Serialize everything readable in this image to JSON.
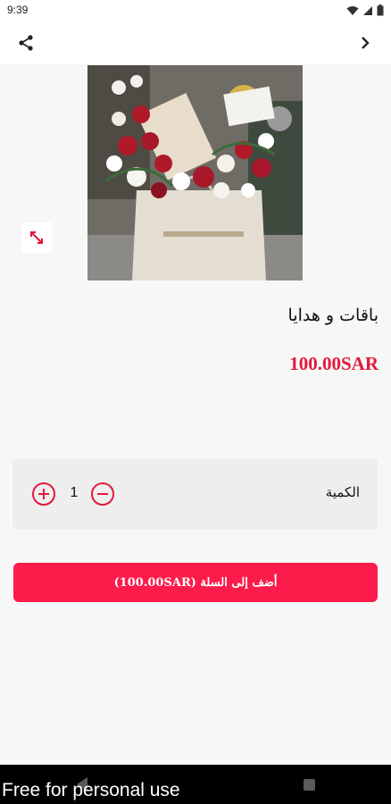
{
  "status_bar": {
    "time": "9:39",
    "icons": [
      "wifi-icon",
      "signal-icon",
      "battery-icon"
    ]
  },
  "app_bar": {
    "icons": [
      "share-icon",
      "chevron-right-icon"
    ]
  },
  "product": {
    "title": "باقات و هدايا",
    "price": "100.00SAR",
    "image_icon": "flower-gift-bag-image",
    "expand_icon": "expand-diagonal-icon"
  },
  "quantity": {
    "label": "الكمية",
    "value": "1",
    "plus_icon": "plus-circle-icon",
    "minus_icon": "minus-circle-icon"
  },
  "cart": {
    "add_label": "أضف إلى السلة (100.00SAR)"
  },
  "watermark": {
    "text": "Free for personal use"
  },
  "colors": {
    "accent": "#e3193d",
    "button": "#fb1c4b",
    "background": "#f7f7f7",
    "quantity_box": "#eeeeee"
  }
}
